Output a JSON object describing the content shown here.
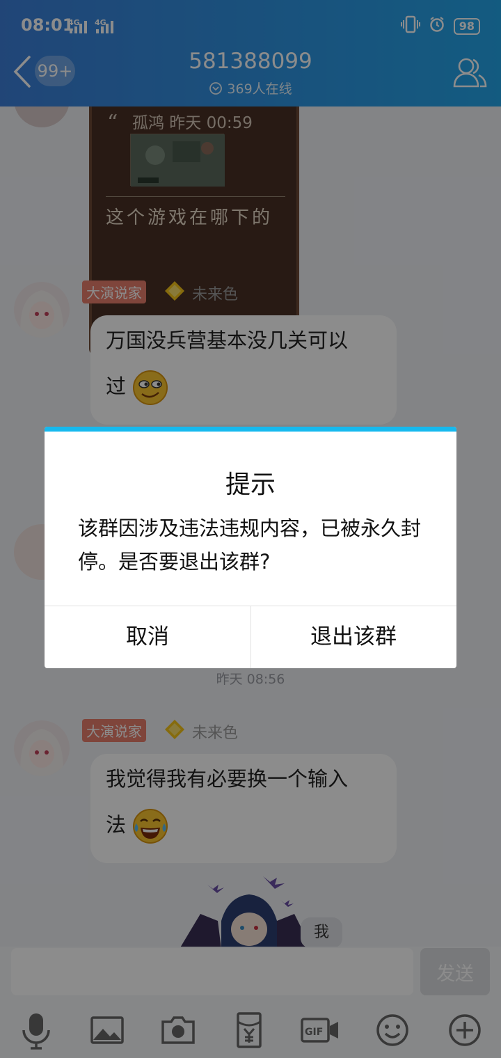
{
  "status_bar": {
    "time": "08:01",
    "signal1": "4G",
    "signal2": "4G",
    "battery": "98"
  },
  "header": {
    "badge": "99+",
    "title": "581388099",
    "subtitle": "369人在线"
  },
  "chat": {
    "sticker": {
      "meta": "孤鸿 昨天 00:59",
      "caption": "这个游戏在哪下的"
    },
    "message1": {
      "tag": "大演说家",
      "name": "未来色",
      "text_line1": "万国没兵营基本没几关可以",
      "text_line2": "过"
    },
    "time_label": "昨天 08:56",
    "message2": {
      "tag": "大演说家",
      "name": "未来色",
      "text_line1": "我觉得我有必要换一个输入",
      "text_line2": "法"
    },
    "partial_label": "我"
  },
  "input": {
    "send_label": "发送"
  },
  "dialog": {
    "title": "提示",
    "message": "该群因涉及违法违规内容，已被永久封停。是否要退出该群?",
    "cancel_label": "取消",
    "confirm_label": "退出该群"
  },
  "icons": {
    "back": "back-arrow-icon",
    "profile": "group-members-icon",
    "online": "chevron-circle-icon",
    "toolbar": [
      "microphone-icon",
      "image-icon",
      "camera-icon",
      "red-packet-icon",
      "gif-icon",
      "emoji-icon",
      "plus-icon"
    ]
  },
  "colors": {
    "header_start": "#3c7fd9",
    "header_end": "#24a6ea",
    "dialog_accent": "#16b9ee",
    "tag": "#e77e6c"
  }
}
